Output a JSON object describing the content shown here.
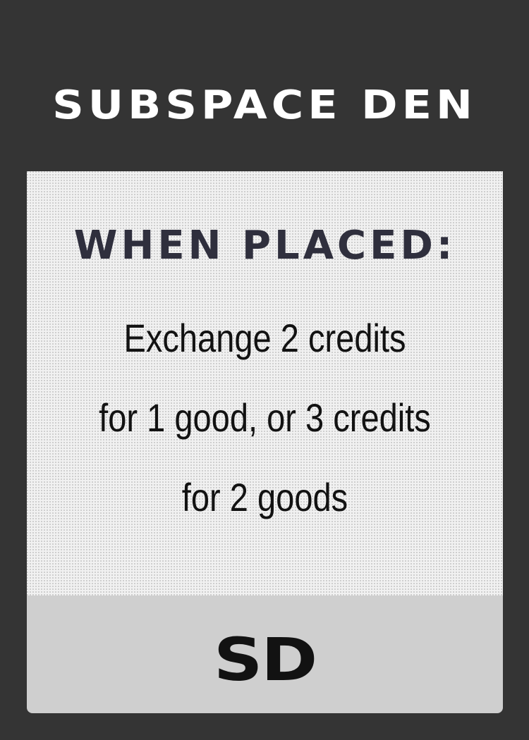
{
  "card": {
    "title": "SUBSPACE DEN",
    "trigger": "WHEN PLACED:",
    "effect_lines": [
      "Exchange 2 credits",
      "for 1 good, or 3 credits",
      "for 2 goods"
    ],
    "code": "SD"
  },
  "colors": {
    "background": "#343434",
    "text_panel": "#f1f1f1",
    "footer_panel": "#cfcfcf",
    "title_text": "#ffffff",
    "trigger_text": "#2f2f3d",
    "body_text": "#121212"
  }
}
